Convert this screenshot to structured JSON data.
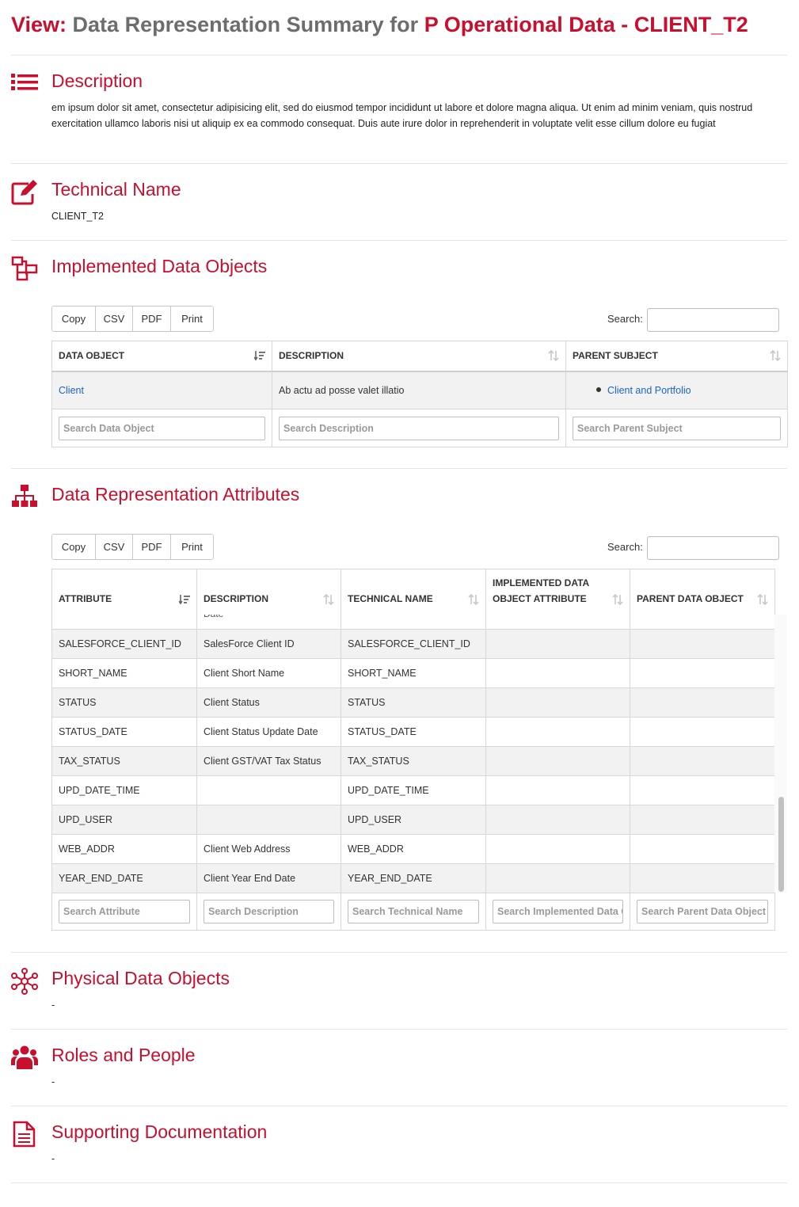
{
  "title": {
    "prefix": "View:",
    "middle": "Data Representation Summary for",
    "subject": "P Operational Data - CLIENT_T2"
  },
  "sections": {
    "description": {
      "heading": "Description",
      "icon": "list-icon",
      "text": "em ipsum dolor sit amet, consectetur adipisicing elit, sed do eiusmod tempor incididunt ut labore et dolore magna aliqua. Ut enim ad minim veniam, quis nostrud exercitation ullamco laboris nisi ut aliquip ex ea commodo consequat. Duis aute irure dolor in reprehenderit in voluptate velit esse cillum dolore eu fugiat"
    },
    "technical_name": {
      "heading": "Technical Name",
      "icon": "edit-icon",
      "value": "CLIENT_T2"
    },
    "implemented": {
      "heading": "Implemented Data Objects",
      "icon": "data-objects-icon"
    },
    "attributes": {
      "heading": "Data Representation Attributes",
      "icon": "hierarchy-icon"
    },
    "physical": {
      "heading": "Physical Data Objects",
      "icon": "network-icon",
      "value": "-"
    },
    "roles": {
      "heading": "Roles and People",
      "icon": "users-icon",
      "value": "-"
    },
    "docs": {
      "heading": "Supporting Documentation",
      "icon": "document-icon",
      "value": "-"
    }
  },
  "buttons": {
    "copy": "Copy",
    "csv": "CSV",
    "pdf": "PDF",
    "print": "Print"
  },
  "search_label": "Search:",
  "implemented_table": {
    "headers": [
      "DATA OBJECT",
      "DESCRIPTION",
      "PARENT SUBJECT"
    ],
    "row": {
      "data_object": "Client",
      "description": "Ab actu ad posse valet illatio",
      "parent_subject": "Client and Portfolio"
    },
    "filters": [
      "Search Data Object",
      "Search Description",
      "Search Parent Subject"
    ]
  },
  "attributes_table": {
    "headers": [
      "ATTRIBUTE",
      "DESCRIPTION",
      "TECHNICAL NAME",
      "IMPLEMENTED DATA OBJECT ATTRIBUTE",
      "PARENT DATA OBJECT"
    ],
    "partial_text": "Date",
    "rows": [
      {
        "attribute": "SALESFORCE_CLIENT_ID",
        "description": "SalesForce Client ID",
        "technical": "SALESFORCE_CLIENT_ID"
      },
      {
        "attribute": "SHORT_NAME",
        "description": "Client Short Name",
        "technical": "SHORT_NAME"
      },
      {
        "attribute": "STATUS",
        "description": "Client Status",
        "technical": "STATUS"
      },
      {
        "attribute": "STATUS_DATE",
        "description": "Client Status Update Date",
        "technical": "STATUS_DATE"
      },
      {
        "attribute": "TAX_STATUS",
        "description": "Client GST/VAT Tax Status",
        "technical": "TAX_STATUS"
      },
      {
        "attribute": "UPD_DATE_TIME",
        "description": "",
        "technical": "UPD_DATE_TIME"
      },
      {
        "attribute": "UPD_USER",
        "description": "",
        "technical": "UPD_USER"
      },
      {
        "attribute": "WEB_ADDR",
        "description": "Client Web Address",
        "technical": "WEB_ADDR"
      },
      {
        "attribute": "YEAR_END_DATE",
        "description": "Client Year End Date",
        "technical": "YEAR_END_DATE"
      }
    ],
    "filters": [
      "Search Attribute",
      "Search Description",
      "Search Technical Name",
      "Search Implemented Data Object Attribute",
      "Search Parent Data Object"
    ]
  },
  "colors": {
    "accent": "#c8102e",
    "link": "#1a64c8",
    "muted": "#6d6d6d"
  }
}
